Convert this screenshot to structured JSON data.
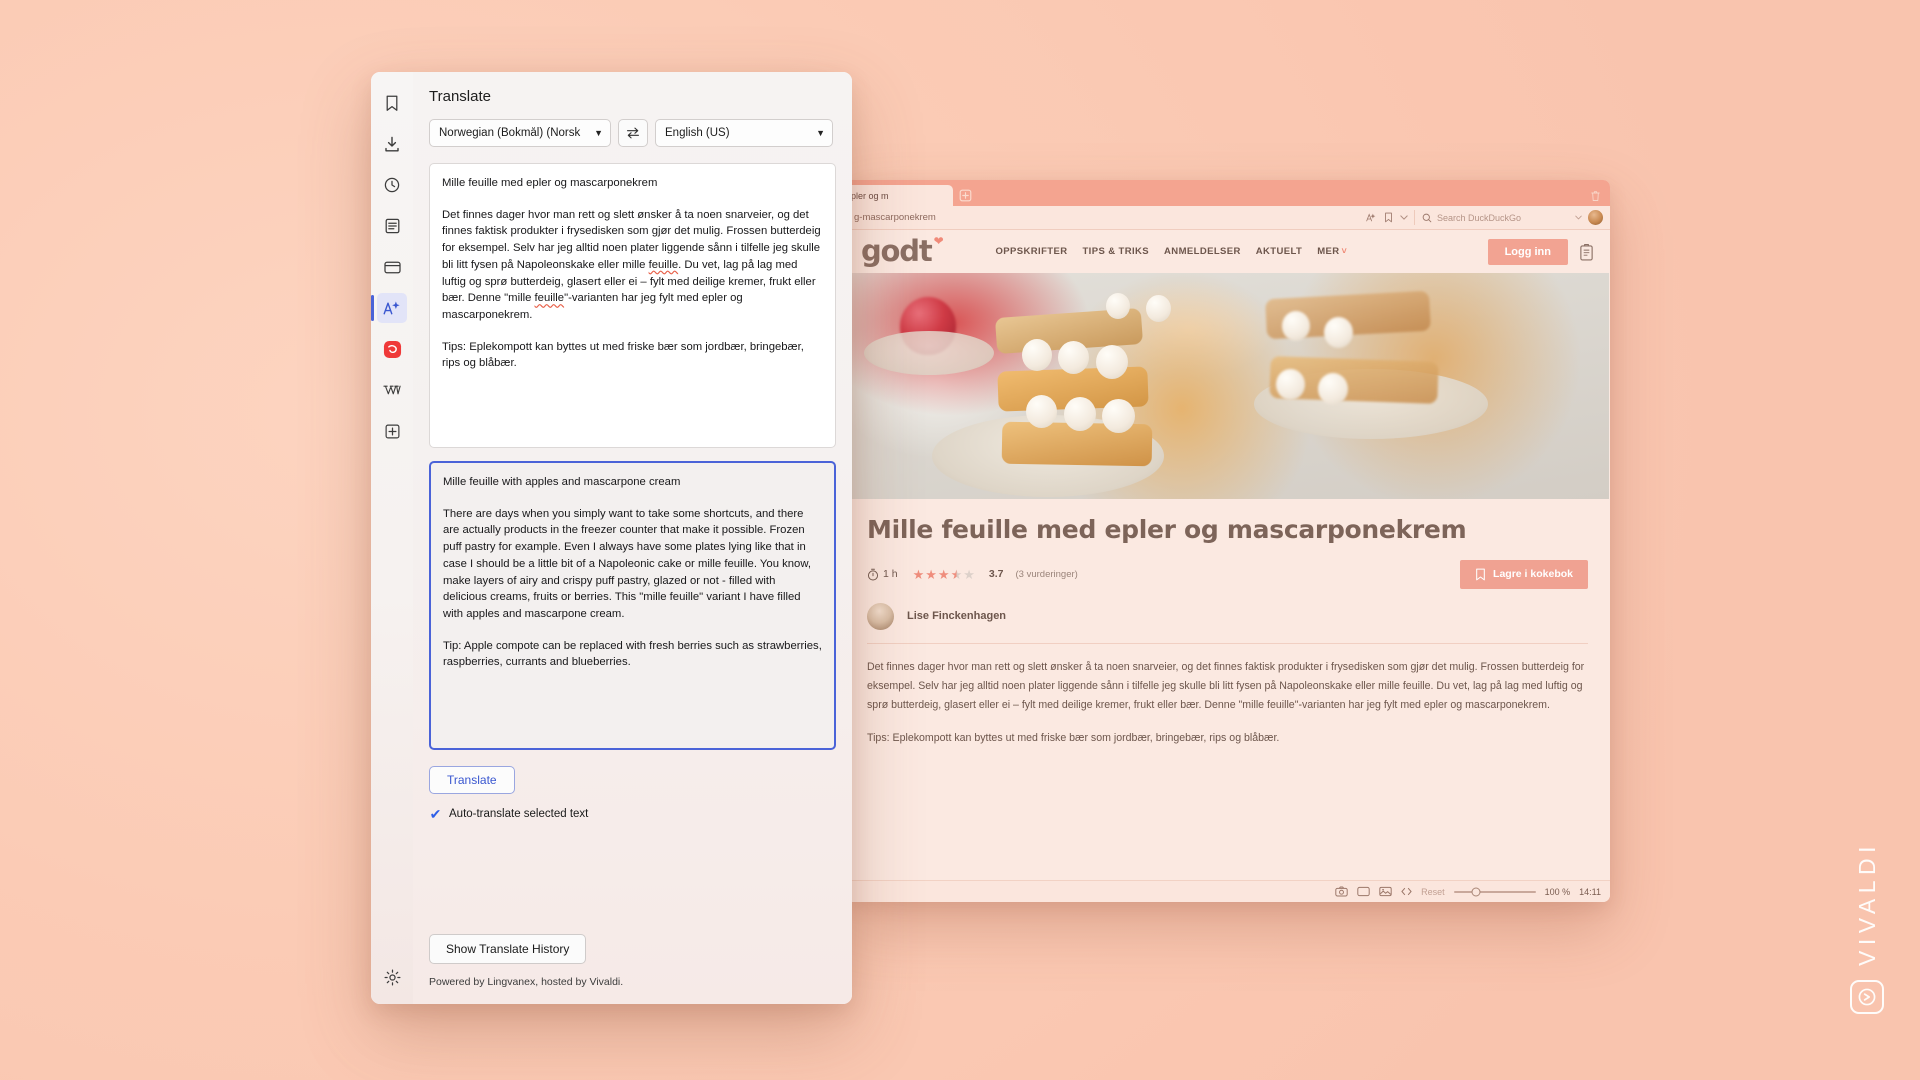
{
  "panel": {
    "title": "Translate",
    "rail": [
      {
        "name": "bookmarks-icon",
        "active": false
      },
      {
        "name": "downloads-icon",
        "active": false
      },
      {
        "name": "history-icon",
        "active": false
      },
      {
        "name": "notes-icon",
        "active": false
      },
      {
        "name": "window-panel-icon",
        "active": false
      },
      {
        "name": "translate-icon",
        "active": true
      },
      {
        "name": "vivaldi-logo-icon",
        "active": false
      },
      {
        "name": "wikipedia-icon",
        "active": false
      },
      {
        "name": "add-panel-icon",
        "active": false
      }
    ],
    "source_language": "Norwegian (Bokmål) (Norsk ",
    "target_language": "English (US)",
    "swap_icon": "swap-arrows-icon",
    "source_text": {
      "heading": "Mille feuille med epler og mascarponekrem",
      "para1_a": "Det finnes dager hvor man rett og slett ønsker å ta noen snarveier, og det finnes faktisk produkter i frysedisken som gjør det mulig. Frossen butterdeig for eksempel. Selv har jeg alltid noen plater liggende sånn i tilfelle jeg skulle bli litt fysen på Napoleonskake eller mille ",
      "misspell1": "feuille",
      "para1_b": ". Du vet, lag på lag med luftig og sprø butterdeig, glasert eller ei – fylt med deilige kremer, frukt eller bær. Denne \"mille ",
      "misspell2": "feuille",
      "para1_c": "\"-varianten har jeg fylt med epler og mascarponekrem.",
      "para2": "Tips: Eplekompott kan byttes ut med friske bær som jordbær, bringebær, rips og blåbær."
    },
    "translated_text": {
      "heading": "Mille feuille with apples and mascarpone cream",
      "para1": "There are days when you simply want to take some shortcuts, and there are actually products in the freezer counter that make it possible. Frozen puff pastry for example. Even I always have some plates lying like that in case I should be a little bit of a Napoleonic cake or mille feuille. You know, make layers of airy and crispy puff pastry, glazed or not - filled with delicious creams, fruits or berries. This \"mille feuille\" variant I have filled with apples and mascarpone cream.",
      "para2": "Tip: Apple compote can be replaced with fresh berries such as strawberries, raspberries, currants and blueberries."
    },
    "translate_button": "Translate",
    "autotranslate_label": "Auto-translate selected text",
    "autotranslate_checked": "✔",
    "history_button": "Show Translate History",
    "powered_by": "Powered by Lingvanex, hosted by Vivaldi.",
    "settings_icon": "gear-icon",
    "accent_color": "#4a63d8"
  },
  "browser": {
    "tab_title": "pler og m",
    "new_tab_icon": "plus-icon",
    "trash_icon": "trash-icon",
    "url": "g-mascarponekrem",
    "addressbar_icons": [
      "translate-icon",
      "bookmark-icon",
      "chevron-down-icon"
    ],
    "search_placeholder": "Search DuckDuckGo",
    "search_engine_icon": "duckduckgo-icon",
    "profile_icon": "profile-avatar",
    "statusbar": {
      "icons": [
        "capture-icon",
        "tiling-icon",
        "image-toggle-icon",
        "developer-tools-icon"
      ],
      "reset_label": "Reset",
      "zoom_level": "100 %",
      "clock": "14:11"
    }
  },
  "site": {
    "logo": "godt",
    "logo_mark": "heart-icon",
    "nav": [
      "OPPSKRIFTER",
      "TIPS & TRIKS",
      "ANMELDELSER",
      "AKTUELT",
      "MER"
    ],
    "nav_caret": "˅",
    "login_button": "Logg inn",
    "cookbook_icon": "cookbook-icon",
    "recipe": {
      "title": "Mille feuille med epler og mascarponekrem",
      "time_icon": "timer-icon",
      "time": "1 h",
      "rating_value": "3.7",
      "rating_count": "(3 vurderinger)",
      "stars_filled": 3,
      "stars_half": 1,
      "stars_empty": 1,
      "save_button": "Lagre i kokebok",
      "save_button_icon": "book-icon",
      "author": "Lise Finckenhagen",
      "author_avatar": "author-avatar",
      "para1": "Det finnes dager hvor man rett og slett ønsker å ta noen snarveier, og det finnes faktisk produkter i frysedisken som gjør det mulig. Frossen butterdeig for eksempel. Selv har jeg alltid noen plater liggende sånn i tilfelle jeg skulle bli litt fysen på Napoleonskake eller mille feuille. Du vet, lag på lag med luftig og sprø butterdeig, glasert eller ei – fylt med deilige kremer, frukt eller bær. Denne \"mille feuille\"-varianten har jeg fylt med epler og mascarponekrem.",
      "para2": "Tips: Eplekompott kan byttes ut med friske bær som jordbær, bringebær, rips og blåbær.",
      "hero_image": "mille-feuille-photo"
    },
    "accent_color": "#f0a292"
  },
  "watermark": {
    "text": "VIVALDI",
    "logo": "vivaldi-logo-icon"
  }
}
